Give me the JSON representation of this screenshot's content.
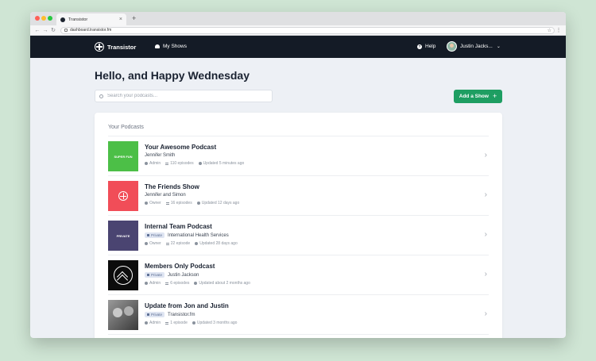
{
  "browser": {
    "tab_title": "Transistor",
    "tab_close": "×",
    "new_tab": "+",
    "url": "dashboard.transistor.fm"
  },
  "nav": {
    "brand": "Transistor",
    "my_shows": "My Shows",
    "help": "Help",
    "help_glyph": "?",
    "user_name": "Justin Jacks...",
    "chevron": "⌄"
  },
  "main": {
    "greeting": "Hello, and Happy Wednesday",
    "search_placeholder": "Search your podcasts...",
    "add_show": "Add a Show",
    "add_show_plus": "+"
  },
  "podcasts": {
    "section_title": "Your Podcasts",
    "chevron": "›",
    "private_label": "Private",
    "items": [
      {
        "art_text": "SUPER FUN",
        "name": "Your Awesome Podcast",
        "author": "Jennifer Smith",
        "role": "Admin",
        "episodes": "110 episodes",
        "updated": "Updated 5 minutes ago",
        "accent": "#4cbf47"
      },
      {
        "art_text": "",
        "name": "The Friends Show",
        "author": "Jennifer and Simon",
        "role": "Owner",
        "episodes": "16 episodes",
        "updated": "Updated 12 days ago",
        "accent": "#f14d58"
      },
      {
        "art_text": "PRIVATE",
        "name": "Internal Team Podcast",
        "author": "International Health Services",
        "role": "Owner",
        "episodes": "22 episode",
        "updated": "Updated 28 days ago",
        "accent": "#4a4471"
      },
      {
        "art_text": "",
        "name": "Members Only Podcast",
        "author": "Justin Jackson",
        "role": "Admin",
        "episodes": "6 episodes",
        "updated": "Updated about 2 months ago",
        "accent": "#0c0c0c"
      },
      {
        "art_text": "",
        "name": "Update from Jon and Justin",
        "author": "Transistor.fm",
        "role": "Admin",
        "episodes": "1 episode",
        "updated": "Updated 3 months ago",
        "accent": "#6b6b6b"
      }
    ]
  },
  "colors": {
    "nav_bg": "#141b26",
    "accent_green": "#1e9e62",
    "page_bg": "#edf0f5"
  }
}
